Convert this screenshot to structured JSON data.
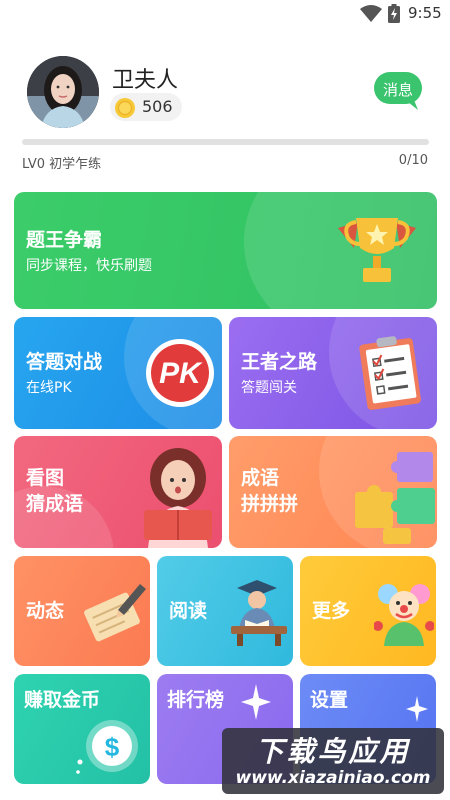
{
  "status_bar": {
    "time": "9:55",
    "icons": [
      "wifi-icon",
      "battery-charging-icon"
    ]
  },
  "profile": {
    "username": "卫夫人",
    "coins": "506",
    "message_button": "消息",
    "progress_fraction": 0.0,
    "level_text": "LV0 初学乍练",
    "level_progress": "0/10"
  },
  "cards": {
    "king": {
      "title": "题王争霸",
      "subtitle": "同步课程，快乐刷题"
    },
    "battle": {
      "title": "答题对战",
      "subtitle": "在线PK",
      "badge": "PK"
    },
    "road": {
      "title": "王者之路",
      "subtitle": "答题闯关"
    },
    "picture": {
      "line1": "看图",
      "line2": "猜成语"
    },
    "idiom": {
      "line1": "成语",
      "line2": "拼拼拼"
    },
    "feed": {
      "title": "动态"
    },
    "read": {
      "title": "阅读"
    },
    "more": {
      "title": "更多"
    },
    "earn": {
      "title": "赚取金币",
      "symbol": "$"
    },
    "rank": {
      "title": "排行榜"
    },
    "settings": {
      "title": "设置"
    }
  },
  "watermark": {
    "line1": "下载鸟应用",
    "line2": "www.xiazainiao.com"
  },
  "colors": {
    "accent_green": "#3bc46e",
    "king": "#38c768",
    "battle": "#2299ec",
    "road": "#8a60ea",
    "picture": "#ee5a75",
    "idiom": "#ff9060",
    "feed": "#fc865b",
    "read": "#43c3e3",
    "more": "#ffc02c",
    "earn": "#29caab",
    "rank": "#9373ef",
    "settings": "#607ff3"
  }
}
